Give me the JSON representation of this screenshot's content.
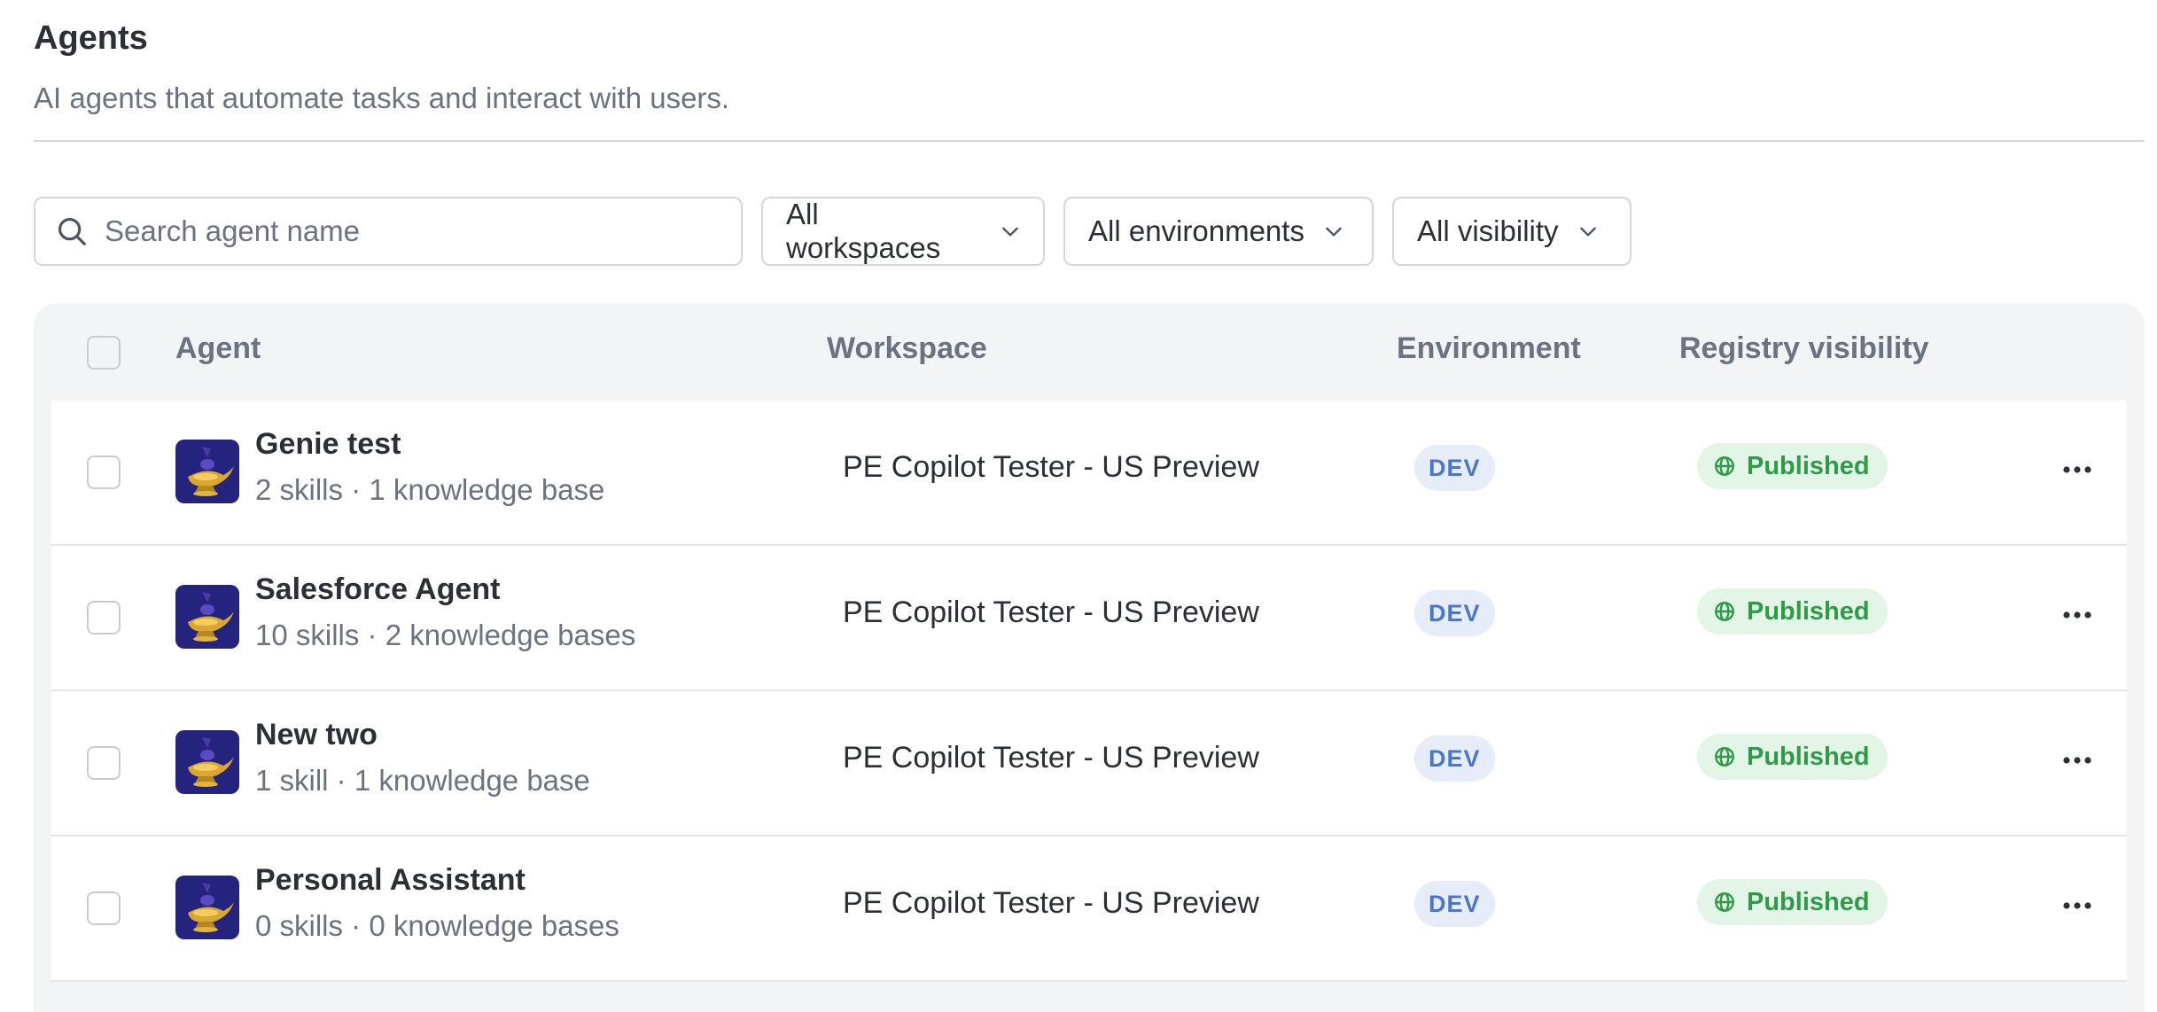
{
  "header": {
    "title": "Agents",
    "subtitle": "AI agents that automate tasks and interact with users."
  },
  "filters": {
    "search_placeholder": "Search agent name",
    "workspace": "All workspaces",
    "environment": "All environments",
    "visibility": "All visibility"
  },
  "table": {
    "columns": [
      "Agent",
      "Workspace",
      "Environment",
      "Registry visibility"
    ],
    "rows": [
      {
        "name": "Genie test",
        "meta": "2 skills · 1 knowledge base",
        "workspace": "PE Copilot Tester - US Preview",
        "environment": "DEV",
        "visibility": "Published"
      },
      {
        "name": "Salesforce Agent",
        "meta": "10 skills · 2 knowledge bases",
        "workspace": "PE Copilot Tester - US Preview",
        "environment": "DEV",
        "visibility": "Published"
      },
      {
        "name": "New two",
        "meta": "1 skill · 1 knowledge base",
        "workspace": "PE Copilot Tester - US Preview",
        "environment": "DEV",
        "visibility": "Published"
      },
      {
        "name": "Personal Assistant",
        "meta": "0 skills · 0 knowledge bases",
        "workspace": "PE Copilot Tester - US Preview",
        "environment": "DEV",
        "visibility": "Published"
      }
    ]
  },
  "icons": {
    "search": "search-icon",
    "dropdown": "chevron-down-icon",
    "visibility": "globe-icon",
    "row_actions": "more-horizontal-icon",
    "agent_avatar": "genie-lamp-icon"
  },
  "colors": {
    "env_badge_bg": "#e6edf9",
    "env_badge_text": "#4a77c9",
    "published_bg": "#e3f5e6",
    "published_text": "#2f9a48",
    "avatar_bg": "#1f2a8a"
  }
}
